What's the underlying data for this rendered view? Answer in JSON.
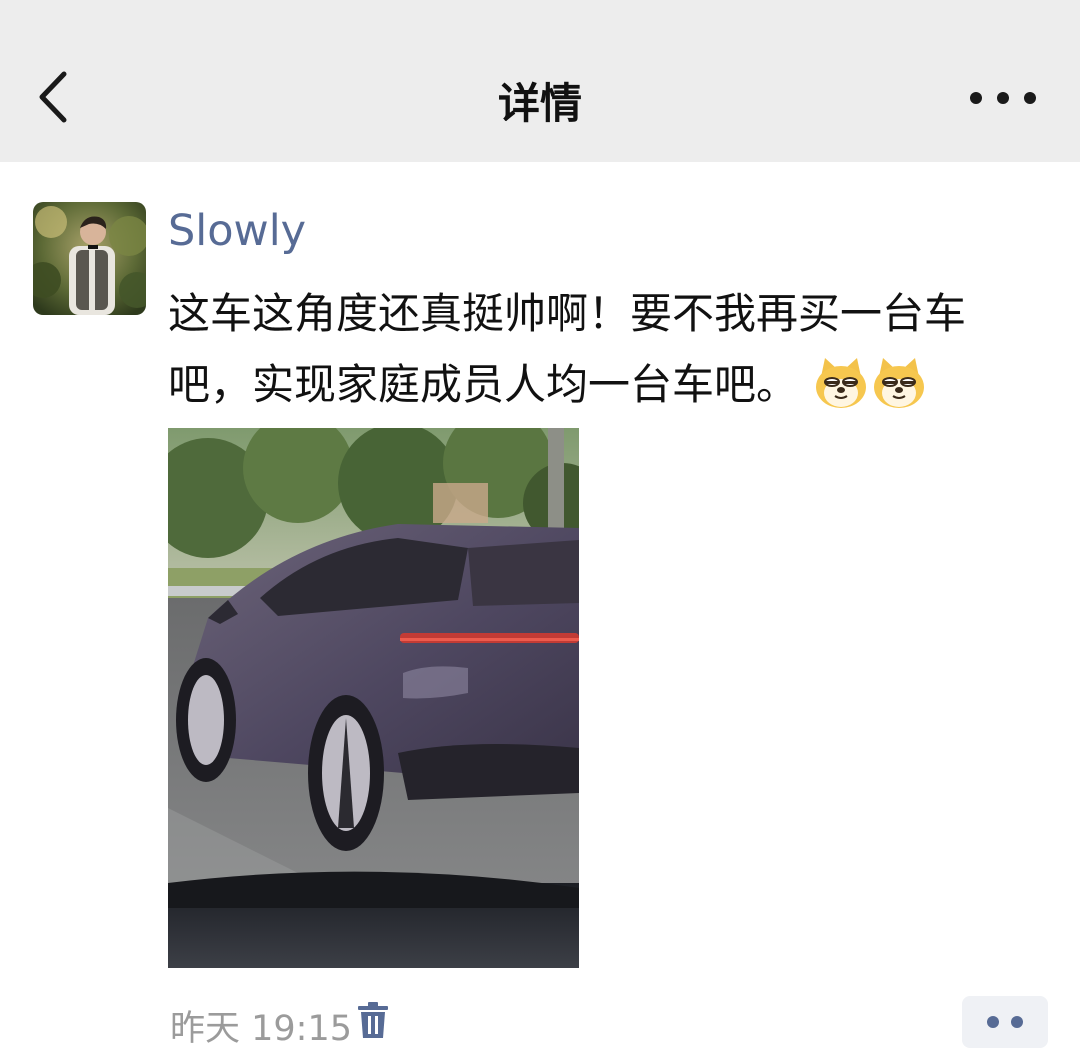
{
  "header": {
    "title": "详情",
    "back_icon": "chevron-left-icon",
    "more_icon": "more-dots-icon"
  },
  "post": {
    "author": "Slowly",
    "text": "这车这角度还真挺帅啊！要不我再买一台车吧，实现家庭成员人均一台车吧。",
    "emoji_count": 2,
    "emoji_icon": "doge-emoji-icon",
    "photo_alt": "photo",
    "timestamp": "昨天 19:15",
    "delete_icon": "trash-icon",
    "action_icon": "comment-like-dots-icon"
  },
  "colors": {
    "header_bg": "#ededed",
    "link_blue": "#576b95",
    "time_gray": "#9b9b9b",
    "action_bg": "#eff1f5"
  }
}
